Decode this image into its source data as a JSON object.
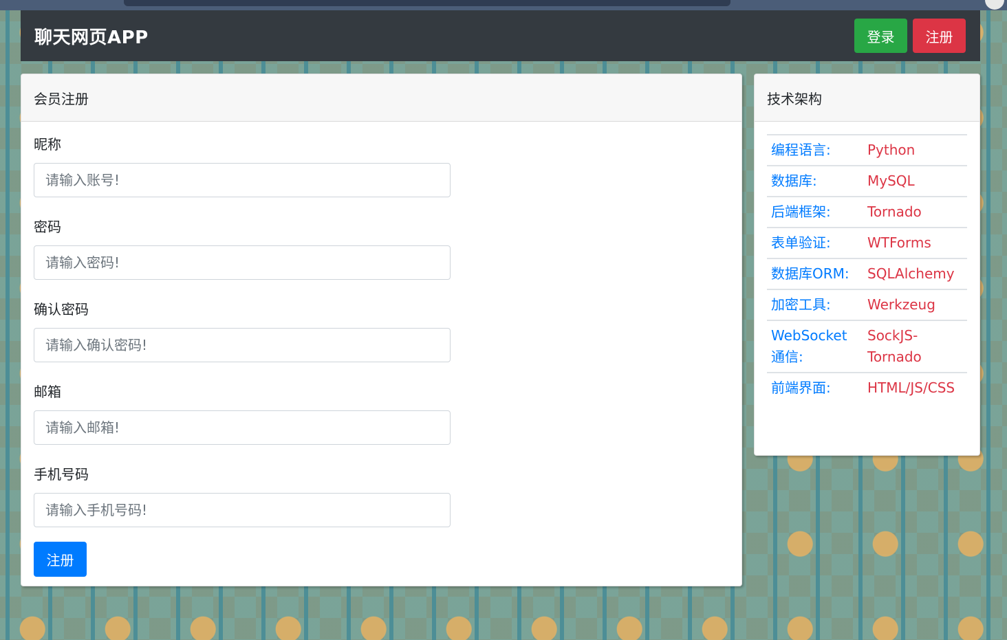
{
  "navbar": {
    "brand": "聊天网页APP",
    "login_label": "登录",
    "register_label": "注册"
  },
  "register_form": {
    "title": "会员注册",
    "fields": [
      {
        "label": "昵称",
        "placeholder": "请输入账号!"
      },
      {
        "label": "密码",
        "placeholder": "请输入密码!"
      },
      {
        "label": "确认密码",
        "placeholder": "请输入确认密码!"
      },
      {
        "label": "邮箱",
        "placeholder": "请输入邮箱!"
      },
      {
        "label": "手机号码",
        "placeholder": "请输入手机号码!"
      }
    ],
    "submit_label": "注册"
  },
  "tech_stack": {
    "title": "技术架构",
    "rows": [
      {
        "key": "编程语言:",
        "value": "Python"
      },
      {
        "key": "数据库:",
        "value": "MySQL"
      },
      {
        "key": "后端框架:",
        "value": "Tornado"
      },
      {
        "key": "表单验证:",
        "value": "WTForms"
      },
      {
        "key": "数据库ORM:",
        "value": "SQLAlchemy"
      },
      {
        "key": "加密工具:",
        "value": "Werkzeug"
      },
      {
        "key": "WebSocket通信:",
        "value": "SockJS-Tornado"
      },
      {
        "key": "前端界面:",
        "value": "HTML/JS/CSS"
      }
    ]
  },
  "colors": {
    "navbar_bg": "#343a40",
    "success": "#28a745",
    "danger": "#dc3545",
    "primary": "#007bff"
  }
}
